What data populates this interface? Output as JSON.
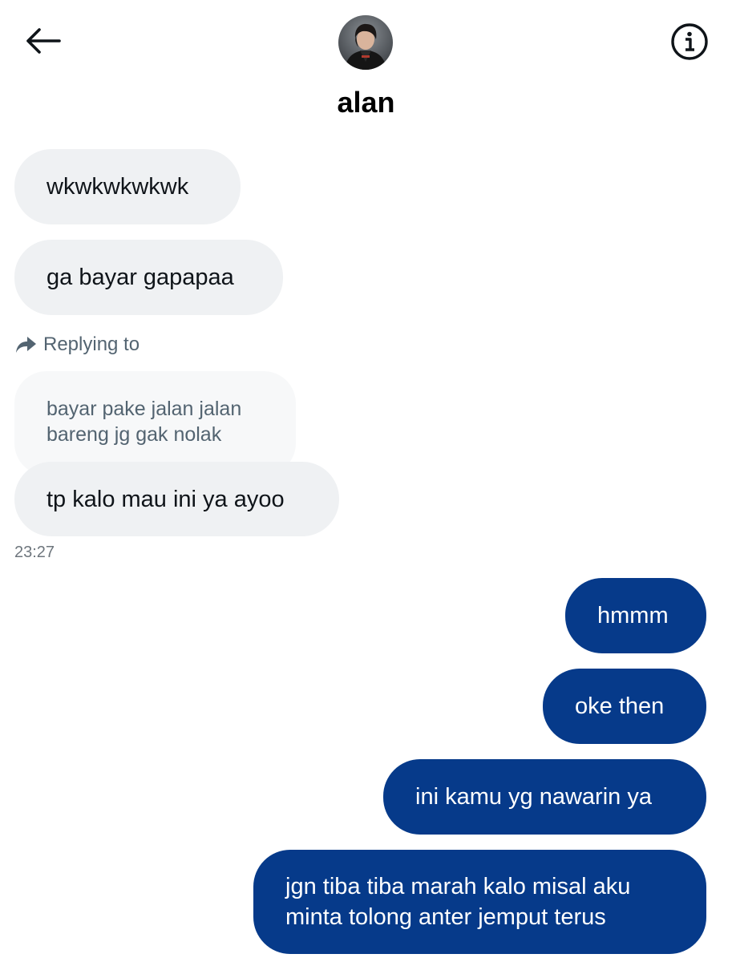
{
  "header": {
    "title": "alan",
    "back_icon": "arrow-left-icon",
    "info_icon": "info-circle-icon"
  },
  "messages": {
    "m1": "wkwkwkwkwk",
    "m2": "ga bayar gapapaa",
    "reply_label": "Replying to",
    "quoted_line1": "bayar pake jalan jalan",
    "quoted_line2": "bareng jg gak nolak",
    "m3": "tp kalo mau ini ya ayoo",
    "timestamp": "23:27",
    "o1": "hmmm",
    "o2": "oke then",
    "o3": "ini kamu yg nawarin ya",
    "o4_line1": "jgn tiba tiba marah kalo misal aku",
    "o4_line2": "minta tolong anter jemput terus"
  },
  "colors": {
    "outgoing_bubble": "#063a8a",
    "incoming_bubble": "#eff1f3",
    "quoted_bubble": "#f7f8f9",
    "secondary_text": "#536471"
  }
}
